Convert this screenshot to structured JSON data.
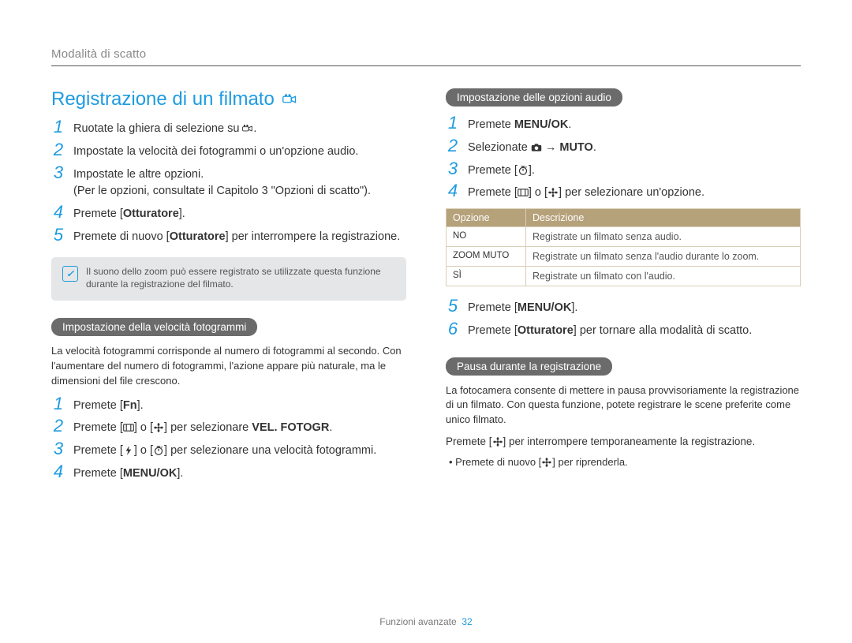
{
  "breadcrumb": "Modalità di scatto",
  "title": "Registrazione di un filmato",
  "left": {
    "steps": [
      {
        "n": "1",
        "parts": [
          "Ruotate la ghiera di selezione su ",
          {
            "icon": "video"
          },
          "."
        ]
      },
      {
        "n": "2",
        "parts": [
          "Impostate la velocità dei fotogrammi o un'opzione audio."
        ]
      },
      {
        "n": "3",
        "parts": [
          "Impostate le altre opzioni.\n(Per le opzioni, consultate il Capitolo 3 \"Opzioni di scatto\")."
        ]
      },
      {
        "n": "4",
        "parts": [
          "Premete [",
          {
            "bold": "Otturatore"
          },
          "]."
        ]
      },
      {
        "n": "5",
        "parts": [
          "Premete di nuovo [",
          {
            "bold": "Otturatore"
          },
          "] per interrompere la registrazione."
        ]
      }
    ],
    "note": "Il suono dello zoom può essere registrato se utilizzate questa funzione durante la registrazione del filmato.",
    "sub_heading": "Impostazione della velocità fotogrammi",
    "sub_intro": "La velocità fotogrammi corrisponde al numero di fotogrammi al secondo. Con l'aumentare del numero di fotogrammi, l'azione appare più naturale, ma le dimensioni del file crescono.",
    "sub_steps": [
      {
        "n": "1",
        "parts": [
          "Premete [",
          {
            "bold": "Fn"
          },
          "]."
        ]
      },
      {
        "n": "2",
        "parts": [
          "Premete [",
          {
            "icon": "disp"
          },
          "] o [",
          {
            "icon": "flower"
          },
          "] per selezionare ",
          {
            "bold": "VEL. FOTOGR"
          },
          "."
        ]
      },
      {
        "n": "3",
        "parts": [
          "Premete [",
          {
            "icon": "flash"
          },
          "] o [",
          {
            "icon": "timer"
          },
          "] per selezionare una velocità fotogrammi."
        ]
      },
      {
        "n": "4",
        "parts": [
          "Premete [",
          {
            "bold": "MENU/OK"
          },
          "]."
        ]
      }
    ]
  },
  "right": {
    "heading_audio": "Impostazione delle opzioni audio",
    "audio_steps": [
      {
        "n": "1",
        "parts": [
          "Premete ",
          {
            "bold": "MENU/OK"
          },
          "."
        ]
      },
      {
        "n": "2",
        "parts": [
          "Selezionate ",
          {
            "icon": "camera"
          },
          " → ",
          {
            "bold": "MUTO"
          },
          "."
        ]
      },
      {
        "n": "3",
        "parts": [
          "Premete [",
          {
            "icon": "timer"
          },
          "]."
        ]
      },
      {
        "n": "4",
        "parts": [
          "Premete [",
          {
            "icon": "disp"
          },
          "] o [",
          {
            "icon": "flower"
          },
          "] per selezionare un'opzione."
        ]
      }
    ],
    "table_headers": {
      "opt": "Opzione",
      "desc": "Descrizione"
    },
    "table_rows": [
      {
        "opt": "NO",
        "desc": "Registrate un filmato senza audio."
      },
      {
        "opt": "ZOOM MUTO",
        "desc": "Registrate un filmato senza l'audio durante lo zoom."
      },
      {
        "opt": "SÌ",
        "desc": "Registrate un filmato con l'audio."
      }
    ],
    "audio_steps2": [
      {
        "n": "5",
        "parts": [
          "Premete [",
          {
            "bold": "MENU/OK"
          },
          "]."
        ]
      },
      {
        "n": "6",
        "parts": [
          "Premete [",
          {
            "bold": "Otturatore"
          },
          "] per tornare alla modalità di scatto."
        ]
      }
    ],
    "heading_pause": "Pausa durante la registrazione",
    "pause_intro": "La fotocamera consente di mettere in pausa provvisoriamente la registrazione di un filmato. Con questa funzione, potete registrare le scene preferite come unico filmato.",
    "pause_line": {
      "parts": [
        "Premete [",
        {
          "icon": "flower"
        },
        "] per interrompere temporaneamente la registrazione."
      ]
    },
    "pause_bullet": {
      "parts": [
        "• Premete di nuovo [",
        {
          "icon": "flower"
        },
        "] per riprenderla."
      ]
    }
  },
  "footer": {
    "section": "Funzioni avanzate",
    "page": "32"
  }
}
